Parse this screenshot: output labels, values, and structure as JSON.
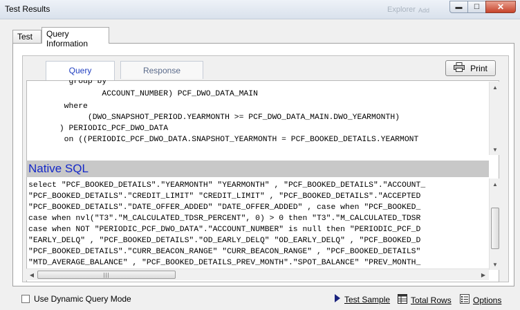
{
  "window": {
    "title": "Test Results",
    "ghost_text": "Explorer",
    "ghost_text2": "Add",
    "controls": {
      "minimize": "▬",
      "maximize": "☐",
      "close": "✕"
    }
  },
  "outer_tabs": [
    {
      "label": "Test",
      "active": false
    },
    {
      "label": "Query Information",
      "active": true
    }
  ],
  "inner_tabs": [
    {
      "label": "Query",
      "active": true
    },
    {
      "label": "Response",
      "active": false
    }
  ],
  "print_button": {
    "label": "Print",
    "icon": "printer-icon"
  },
  "query_sql_lines": [
    "         group by",
    "                ACCOUNT_NUMBER) PCF_DWO_DATA_MAIN",
    "        where",
    "             (DWO_SNAPSHOT_PERIOD.YEARMONTH >= PCF_DWO_DATA_MAIN.DWO_YEARMONTH)",
    "       ) PERIODIC_PCF_DWO_DATA",
    "        on ((PERIODIC_PCF_DWO_DATA.SNAPSHOT_YEARMONTH = PCF_BOOKED_DETAILS.YEARMONT"
  ],
  "native_sql": {
    "header": "Native SQL",
    "lines": [
      "select \"PCF_BOOKED_DETAILS\".\"YEARMONTH\" \"YEARMONTH\" , \"PCF_BOOKED_DETAILS\".\"ACCOUNT_",
      "\"PCF_BOOKED_DETAILS\".\"CREDIT_LIMIT\" \"CREDIT_LIMIT\" , \"PCF_BOOKED_DETAILS\".\"ACCEPTED",
      "\"PCF_BOOKED_DETAILS\".\"DATE_OFFER_ADDED\" \"DATE_OFFER_ADDED\" , case when \"PCF_BOOKED_",
      "case when nvl(\"T3\".\"M_CALCULATED_TDSR_PERCENT\", 0) > 0 then \"T3\".\"M_CALCULATED_TDSR",
      "case when NOT \"PERIODIC_PCF_DWO_DATA\".\"ACCOUNT_NUMBER\" is null then \"PERIODIC_PCF_D",
      "\"EARLY_DELQ\" , \"PCF_BOOKED_DETAILS\".\"OD_EARLY_DELQ\" \"OD_EARLY_DELQ\" , \"PCF_BOOKED_D",
      "\"PCF_BOOKED_DETAILS\".\"CURR_BEACON_RANGE\" \"CURR_BEACON_RANGE\" , \"PCF_BOOKED_DETAILS\"",
      "\"MTD_AVERAGE_BALANCE\" , \"PCF_BOOKED_DETAILS_PREV_MONTH\".\"SPOT_BALANCE\" \"PREV_MONTH_"
    ]
  },
  "bottom_bar": {
    "checkbox_label": "Use Dynamic Query Mode",
    "checkbox_checked": false,
    "test_sample": {
      "label": "Test Sample",
      "icon": "play-arrow-icon"
    },
    "total_rows": {
      "label": "Total Rows",
      "icon": "database-icon"
    },
    "options": {
      "label": "Options",
      "icon": "options-list-icon"
    }
  },
  "colors": {
    "native_sql_header_bg": "#c8c8c8",
    "native_sql_header_text": "#1428c8",
    "active_tab_text": "#1f3ec0"
  }
}
